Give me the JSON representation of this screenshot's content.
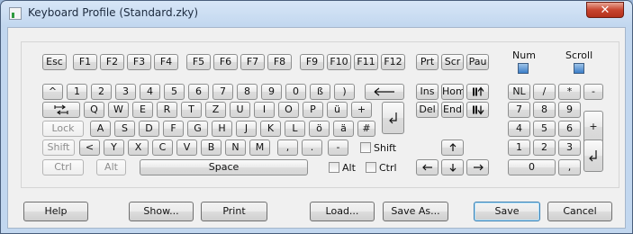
{
  "window": {
    "title": "Keyboard Profile (Standard.zky)",
    "close_label": "✕"
  },
  "indicators": {
    "num": "Num",
    "scroll": "Scroll"
  },
  "keys": {
    "esc": "Esc",
    "f1": "F1",
    "f2": "F2",
    "f3": "F3",
    "f4": "F4",
    "f5": "F5",
    "f6": "F6",
    "f7": "F7",
    "f8": "F8",
    "f9": "F9",
    "f10": "F10",
    "f11": "F11",
    "f12": "F12",
    "prt": "Prt",
    "scr": "Scr",
    "pau": "Pau",
    "caret": "^",
    "d1": "1",
    "d2": "2",
    "d3": "3",
    "d4": "4",
    "d5": "5",
    "d6": "6",
    "d7": "7",
    "d8": "8",
    "d9": "9",
    "d0": "0",
    "sz": "ß",
    "paren": ")",
    "q": "Q",
    "w": "W",
    "e": "E",
    "r": "R",
    "t": "T",
    "z": "Z",
    "u": "U",
    "i": "I",
    "o": "O",
    "p": "P",
    "ue": "ü",
    "plus": "+",
    "lock": "Lock",
    "a": "A",
    "s": "S",
    "d": "D",
    "f": "F",
    "g": "G",
    "h": "H",
    "j": "J",
    "k": "K",
    "l": "L",
    "oe": "ö",
    "ae": "ä",
    "hash": "#",
    "shift": "Shift",
    "lt": "<",
    "y": "Y",
    "x": "X",
    "c": "C",
    "v": "V",
    "b": "B",
    "n": "N",
    "m": "M",
    "comma": ",",
    "period": ".",
    "minus": "-",
    "ctrl": "Ctrl",
    "alt": "Alt",
    "space": "Space",
    "ins": "Ins",
    "hom": "Hom",
    "del": "Del",
    "end": "End",
    "nl": "NL",
    "slash": "/",
    "star": "*",
    "npminus": "-",
    "n7": "7",
    "n8": "8",
    "n9": "9",
    "npplus": "+",
    "n4": "4",
    "n5": "5",
    "n6": "6",
    "n1": "1",
    "n2": "2",
    "n3": "3",
    "n0": "0",
    "npcomma": ","
  },
  "modifiers": {
    "shift": "Shift",
    "alt": "Alt",
    "ctrl": "Ctrl"
  },
  "buttons": {
    "help": "Help",
    "show": "Show...",
    "print": "Print",
    "load": "Load...",
    "save_as": "Save As...",
    "save": "Save",
    "cancel": "Cancel"
  }
}
